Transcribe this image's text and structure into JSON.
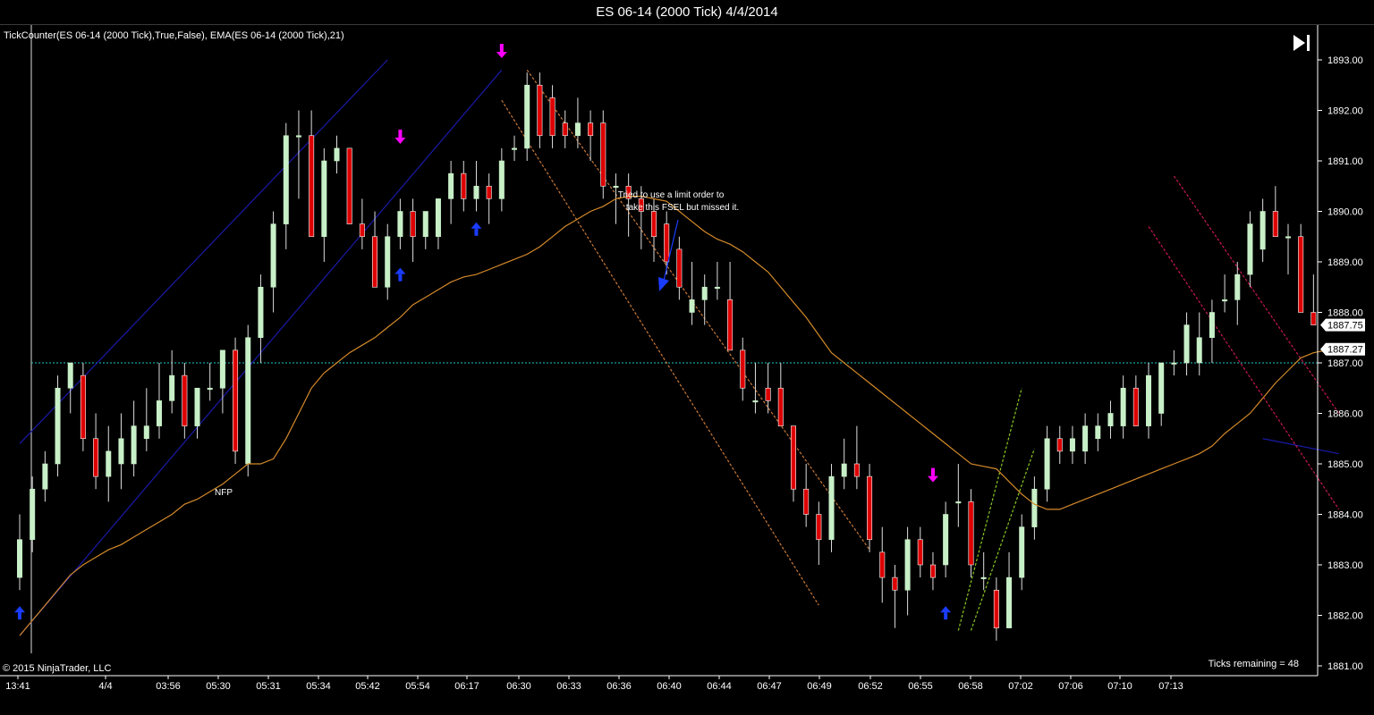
{
  "window": {
    "title": "ES 06-14 (2000 Tick)  4/4/2014"
  },
  "indicator_label": "TickCounter(ES 06-14 (2000 Tick),True,False), EMA(ES 06-14 (2000 Tick),21)",
  "copyright": "© 2015 NinjaTrader, LLC",
  "ticks_remaining": "Ticks remaining = 48",
  "annotation_text": [
    "Tried to use a limit order to",
    "take this FSEL but missed it."
  ],
  "nfp_label": "NFP",
  "colors": {
    "background": "#000000",
    "up_candle": "#c8f0c8",
    "down_candle": "#dd0000",
    "wick": "#dddddd",
    "ema": "#d48a2a",
    "channel_blue": "#1a1aa8",
    "channel_orange": "#c87838",
    "channel_green": "#88c820",
    "channel_red": "#c81850",
    "ref_line": "#20c8c8",
    "axis": "#ffffff",
    "arrow_down": "#ff00ff",
    "arrow_up": "#1a3cff"
  },
  "chart_data": {
    "type": "candlestick",
    "ylim": [
      1880.5,
      1893.25
    ],
    "y_ticks": [
      "1893.00",
      "1892.00",
      "1891.00",
      "1890.00",
      "1889.00",
      "1888.00",
      "1887.00",
      "1886.00",
      "1885.00",
      "1884.00",
      "1883.00",
      "1882.00",
      "1881.00"
    ],
    "x_ticks": [
      "13:41",
      "4/4",
      "03:56",
      "05:30",
      "05:31",
      "05:34",
      "05:42",
      "05:54",
      "06:17",
      "06:30",
      "06:33",
      "06:36",
      "06:40",
      "06:44",
      "06:47",
      "06:49",
      "06:52",
      "06:55",
      "06:58",
      "07:02",
      "07:06",
      "07:10",
      "07:13"
    ],
    "price_labels": [
      {
        "label": "1887.75",
        "value": 1887.75
      },
      {
        "label": "1887.27",
        "value": 1887.27
      }
    ],
    "reference_line": 1887.0,
    "bars": [
      {
        "o": 1882.75,
        "h": 1884.0,
        "l": 1882.5,
        "c": 1883.5
      },
      {
        "o": 1883.5,
        "h": 1884.75,
        "l": 1883.25,
        "c": 1884.5
      },
      {
        "o": 1884.5,
        "h": 1885.25,
        "l": 1884.25,
        "c": 1885.0
      },
      {
        "o": 1885.0,
        "h": 1886.75,
        "l": 1884.75,
        "c": 1886.5
      },
      {
        "o": 1886.5,
        "h": 1887.0,
        "l": 1886.0,
        "c": 1887.0
      },
      {
        "o": 1886.75,
        "h": 1887.0,
        "l": 1885.25,
        "c": 1885.5
      },
      {
        "o": 1885.5,
        "h": 1886.0,
        "l": 1884.5,
        "c": 1884.75
      },
      {
        "o": 1884.75,
        "h": 1885.75,
        "l": 1884.25,
        "c": 1885.25
      },
      {
        "o": 1885.0,
        "h": 1886.0,
        "l": 1884.5,
        "c": 1885.5
      },
      {
        "o": 1885.0,
        "h": 1886.25,
        "l": 1884.75,
        "c": 1885.75
      },
      {
        "o": 1885.5,
        "h": 1886.5,
        "l": 1885.25,
        "c": 1885.75
      },
      {
        "o": 1885.75,
        "h": 1887.0,
        "l": 1885.5,
        "c": 1886.25
      },
      {
        "o": 1886.25,
        "h": 1887.25,
        "l": 1886.0,
        "c": 1886.75
      },
      {
        "o": 1886.75,
        "h": 1887.0,
        "l": 1885.5,
        "c": 1885.75
      },
      {
        "o": 1885.75,
        "h": 1886.5,
        "l": 1885.5,
        "c": 1886.5
      },
      {
        "o": 1886.5,
        "h": 1887.0,
        "l": 1886.25,
        "c": 1886.5
      },
      {
        "o": 1886.5,
        "h": 1887.25,
        "l": 1886.0,
        "c": 1887.25
      },
      {
        "o": 1887.25,
        "h": 1887.5,
        "l": 1885.0,
        "c": 1885.25
      },
      {
        "o": 1885.0,
        "h": 1887.75,
        "l": 1884.75,
        "c": 1887.5
      },
      {
        "o": 1887.5,
        "h": 1888.75,
        "l": 1887.0,
        "c": 1888.5
      },
      {
        "o": 1888.5,
        "h": 1890.0,
        "l": 1888.0,
        "c": 1889.75
      },
      {
        "o": 1889.75,
        "h": 1891.75,
        "l": 1889.25,
        "c": 1891.5
      },
      {
        "o": 1891.5,
        "h": 1892.0,
        "l": 1890.25,
        "c": 1891.5
      },
      {
        "o": 1891.5,
        "h": 1892.0,
        "l": 1889.5,
        "c": 1889.5
      },
      {
        "o": 1889.5,
        "h": 1891.25,
        "l": 1889.0,
        "c": 1891.0
      },
      {
        "o": 1891.0,
        "h": 1891.5,
        "l": 1890.75,
        "c": 1891.25
      },
      {
        "o": 1891.25,
        "h": 1891.25,
        "l": 1889.75,
        "c": 1889.75
      },
      {
        "o": 1889.75,
        "h": 1890.25,
        "l": 1889.25,
        "c": 1889.5
      },
      {
        "o": 1889.5,
        "h": 1890.0,
        "l": 1888.5,
        "c": 1888.5
      },
      {
        "o": 1888.5,
        "h": 1889.75,
        "l": 1888.25,
        "c": 1889.5
      },
      {
        "o": 1889.5,
        "h": 1890.25,
        "l": 1889.25,
        "c": 1890.0
      },
      {
        "o": 1890.0,
        "h": 1890.25,
        "l": 1889.0,
        "c": 1889.5
      },
      {
        "o": 1889.5,
        "h": 1890.0,
        "l": 1889.25,
        "c": 1890.0
      },
      {
        "o": 1889.5,
        "h": 1890.25,
        "l": 1889.25,
        "c": 1890.25
      },
      {
        "o": 1890.25,
        "h": 1891.0,
        "l": 1889.75,
        "c": 1890.75
      },
      {
        "o": 1890.75,
        "h": 1891.0,
        "l": 1890.0,
        "c": 1890.25
      },
      {
        "o": 1890.25,
        "h": 1891.0,
        "l": 1890.0,
        "c": 1890.5
      },
      {
        "o": 1890.5,
        "h": 1890.75,
        "l": 1889.75,
        "c": 1890.25
      },
      {
        "o": 1890.25,
        "h": 1891.25,
        "l": 1890.0,
        "c": 1891.0
      },
      {
        "o": 1891.25,
        "h": 1891.5,
        "l": 1891.0,
        "c": 1891.25
      },
      {
        "o": 1891.25,
        "h": 1892.75,
        "l": 1891.0,
        "c": 1892.5
      },
      {
        "o": 1892.5,
        "h": 1892.75,
        "l": 1891.25,
        "c": 1891.5
      },
      {
        "o": 1892.25,
        "h": 1892.5,
        "l": 1891.25,
        "c": 1891.5
      },
      {
        "o": 1891.75,
        "h": 1892.0,
        "l": 1891.25,
        "c": 1891.5
      },
      {
        "o": 1891.5,
        "h": 1892.25,
        "l": 1891.25,
        "c": 1891.75
      },
      {
        "o": 1891.75,
        "h": 1892.0,
        "l": 1891.0,
        "c": 1891.5
      },
      {
        "o": 1891.75,
        "h": 1892.0,
        "l": 1890.25,
        "c": 1890.5
      },
      {
        "o": 1890.5,
        "h": 1890.75,
        "l": 1889.75,
        "c": 1890.5
      },
      {
        "o": 1890.5,
        "h": 1890.75,
        "l": 1889.5,
        "c": 1890.25
      },
      {
        "o": 1890.25,
        "h": 1890.5,
        "l": 1889.25,
        "c": 1890.0
      },
      {
        "o": 1890.0,
        "h": 1890.25,
        "l": 1889.0,
        "c": 1889.5
      },
      {
        "o": 1889.75,
        "h": 1890.0,
        "l": 1888.75,
        "c": 1889.0
      },
      {
        "o": 1889.25,
        "h": 1889.5,
        "l": 1888.25,
        "c": 1888.5
      },
      {
        "o": 1888.0,
        "h": 1889.0,
        "l": 1887.75,
        "c": 1888.25
      },
      {
        "o": 1888.25,
        "h": 1888.75,
        "l": 1887.75,
        "c": 1888.5
      },
      {
        "o": 1888.5,
        "h": 1889.0,
        "l": 1888.25,
        "c": 1888.5
      },
      {
        "o": 1888.25,
        "h": 1889.0,
        "l": 1887.25,
        "c": 1887.25
      },
      {
        "o": 1887.25,
        "h": 1887.5,
        "l": 1886.25,
        "c": 1886.5
      },
      {
        "o": 1886.25,
        "h": 1887.0,
        "l": 1886.0,
        "c": 1886.25
      },
      {
        "o": 1886.5,
        "h": 1887.0,
        "l": 1886.0,
        "c": 1886.25
      },
      {
        "o": 1886.5,
        "h": 1887.0,
        "l": 1885.75,
        "c": 1885.75
      },
      {
        "o": 1885.75,
        "h": 1885.75,
        "l": 1884.25,
        "c": 1884.5
      },
      {
        "o": 1884.5,
        "h": 1885.0,
        "l": 1883.75,
        "c": 1884.0
      },
      {
        "o": 1884.0,
        "h": 1884.25,
        "l": 1883.0,
        "c": 1883.5
      },
      {
        "o": 1883.5,
        "h": 1885.0,
        "l": 1883.25,
        "c": 1884.75
      },
      {
        "o": 1884.75,
        "h": 1885.5,
        "l": 1884.5,
        "c": 1885.0
      },
      {
        "o": 1885.0,
        "h": 1885.75,
        "l": 1884.5,
        "c": 1884.75
      },
      {
        "o": 1884.75,
        "h": 1885.0,
        "l": 1883.25,
        "c": 1883.5
      },
      {
        "o": 1883.25,
        "h": 1883.75,
        "l": 1882.25,
        "c": 1882.75
      },
      {
        "o": 1882.75,
        "h": 1883.0,
        "l": 1881.75,
        "c": 1882.5
      },
      {
        "o": 1882.5,
        "h": 1883.75,
        "l": 1882.0,
        "c": 1883.5
      },
      {
        "o": 1883.5,
        "h": 1883.75,
        "l": 1882.75,
        "c": 1883.0
      },
      {
        "o": 1883.0,
        "h": 1883.25,
        "l": 1882.5,
        "c": 1882.75
      },
      {
        "o": 1883.0,
        "h": 1884.25,
        "l": 1882.75,
        "c": 1884.0
      },
      {
        "o": 1884.25,
        "h": 1885.0,
        "l": 1883.75,
        "c": 1884.25
      },
      {
        "o": 1884.25,
        "h": 1884.5,
        "l": 1882.75,
        "c": 1883.0
      },
      {
        "o": 1882.75,
        "h": 1883.25,
        "l": 1882.5,
        "c": 1882.75
      },
      {
        "o": 1882.5,
        "h": 1882.75,
        "l": 1881.5,
        "c": 1881.75
      },
      {
        "o": 1881.75,
        "h": 1883.25,
        "l": 1881.75,
        "c": 1882.75
      },
      {
        "o": 1882.75,
        "h": 1884.0,
        "l": 1882.5,
        "c": 1883.75
      },
      {
        "o": 1883.75,
        "h": 1884.75,
        "l": 1883.5,
        "c": 1884.5
      },
      {
        "o": 1884.5,
        "h": 1885.75,
        "l": 1884.25,
        "c": 1885.5
      },
      {
        "o": 1885.5,
        "h": 1885.75,
        "l": 1885.0,
        "c": 1885.25
      },
      {
        "o": 1885.25,
        "h": 1885.75,
        "l": 1885.0,
        "c": 1885.5
      },
      {
        "o": 1885.25,
        "h": 1886.0,
        "l": 1885.0,
        "c": 1885.75
      },
      {
        "o": 1885.5,
        "h": 1886.0,
        "l": 1885.25,
        "c": 1885.75
      },
      {
        "o": 1885.75,
        "h": 1886.25,
        "l": 1885.5,
        "c": 1886.0
      },
      {
        "o": 1885.75,
        "h": 1886.75,
        "l": 1885.5,
        "c": 1886.5
      },
      {
        "o": 1886.5,
        "h": 1886.75,
        "l": 1885.75,
        "c": 1885.75
      },
      {
        "o": 1885.75,
        "h": 1887.0,
        "l": 1885.5,
        "c": 1886.75
      },
      {
        "o": 1886.0,
        "h": 1887.0,
        "l": 1885.75,
        "c": 1887.0
      },
      {
        "o": 1887.0,
        "h": 1887.25,
        "l": 1886.75,
        "c": 1887.0
      },
      {
        "o": 1887.0,
        "h": 1888.0,
        "l": 1886.75,
        "c": 1887.75
      },
      {
        "o": 1887.0,
        "h": 1888.0,
        "l": 1886.75,
        "c": 1887.5
      },
      {
        "o": 1887.5,
        "h": 1888.25,
        "l": 1887.0,
        "c": 1888.0
      },
      {
        "o": 1888.25,
        "h": 1888.75,
        "l": 1888.0,
        "c": 1888.25
      },
      {
        "o": 1888.25,
        "h": 1889.0,
        "l": 1887.75,
        "c": 1888.75
      },
      {
        "o": 1888.75,
        "h": 1890.0,
        "l": 1888.5,
        "c": 1889.75
      },
      {
        "o": 1889.25,
        "h": 1890.25,
        "l": 1889.0,
        "c": 1890.0
      },
      {
        "o": 1890.0,
        "h": 1890.5,
        "l": 1889.5,
        "c": 1889.5
      },
      {
        "o": 1889.5,
        "h": 1889.75,
        "l": 1888.75,
        "c": 1889.5
      },
      {
        "o": 1889.5,
        "h": 1889.75,
        "l": 1888.0,
        "c": 1888.0
      },
      {
        "o": 1888.0,
        "h": 1888.75,
        "l": 1887.75,
        "c": 1887.75
      }
    ],
    "ema": [
      1881.6,
      1881.9,
      1882.2,
      1882.5,
      1882.8,
      1883.0,
      1883.15,
      1883.3,
      1883.4,
      1883.55,
      1883.7,
      1883.85,
      1884.0,
      1884.2,
      1884.3,
      1884.45,
      1884.6,
      1884.8,
      1885.0,
      1885.0,
      1885.1,
      1885.5,
      1886.0,
      1886.5,
      1886.8,
      1887.0,
      1887.2,
      1887.35,
      1887.5,
      1887.7,
      1887.9,
      1888.15,
      1888.3,
      1888.45,
      1888.6,
      1888.7,
      1888.75,
      1888.85,
      1888.95,
      1889.05,
      1889.15,
      1889.3,
      1889.5,
      1889.7,
      1889.85,
      1890.0,
      1890.1,
      1890.25,
      1890.3,
      1890.3,
      1890.25,
      1890.2,
      1890.0,
      1889.8,
      1889.6,
      1889.45,
      1889.35,
      1889.2,
      1889.0,
      1888.8,
      1888.5,
      1888.2,
      1887.9,
      1887.55,
      1887.2,
      1887.0,
      1886.8,
      1886.6,
      1886.4,
      1886.2,
      1886.0,
      1885.8,
      1885.6,
      1885.4,
      1885.2,
      1885.0,
      1884.95,
      1884.9,
      1884.65,
      1884.4,
      1884.2,
      1884.1,
      1884.1,
      1884.2,
      1884.3,
      1884.4,
      1884.5,
      1884.6,
      1884.7,
      1884.8,
      1884.9,
      1885.0,
      1885.1,
      1885.2,
      1885.35,
      1885.6,
      1885.8,
      1886.0,
      1886.3,
      1886.6,
      1886.85,
      1887.1,
      1887.2,
      1887.25,
      1887.27
    ],
    "channels": [
      {
        "color": "blue",
        "x": [
          0,
          29
        ],
        "y": [
          1885.4,
          1893.0
        ],
        "dash": false
      },
      {
        "color": "blue",
        "x": [
          0,
          38
        ],
        "y": [
          1881.6,
          1892.8
        ],
        "dash": false
      },
      {
        "color": "blue",
        "x": [
          98,
          104
        ],
        "y": [
          1885.5,
          1885.2
        ],
        "dash": false
      },
      {
        "color": "orange",
        "x": [
          38,
          63
        ],
        "y": [
          1892.2,
          1882.2
        ],
        "dash": true
      },
      {
        "color": "orange",
        "x": [
          40,
          67
        ],
        "y": [
          1892.8,
          1883.3
        ],
        "dash": true
      },
      {
        "color": "green",
        "x": [
          74,
          79
        ],
        "y": [
          1881.7,
          1886.5
        ],
        "dash": true
      },
      {
        "color": "green",
        "x": [
          75,
          80
        ],
        "y": [
          1881.7,
          1885.3
        ],
        "dash": true
      },
      {
        "color": "red",
        "x": [
          89,
          104
        ],
        "y": [
          1889.7,
          1884.1
        ],
        "dash": true
      },
      {
        "color": "red",
        "x": [
          91,
          104
        ],
        "y": [
          1890.7,
          1886.0
        ],
        "dash": true
      }
    ],
    "markers_down": [
      {
        "bar": 30,
        "price": 1891.3
      },
      {
        "bar": 38,
        "price": 1893.0
      },
      {
        "bar": 72,
        "price": 1884.6
      }
    ],
    "markers_up": [
      {
        "bar": 0,
        "price": 1882.2
      },
      {
        "bar": 30,
        "price": 1888.9
      },
      {
        "bar": 36,
        "price": 1889.8
      },
      {
        "bar": 73,
        "price": 1882.2
      }
    ]
  }
}
